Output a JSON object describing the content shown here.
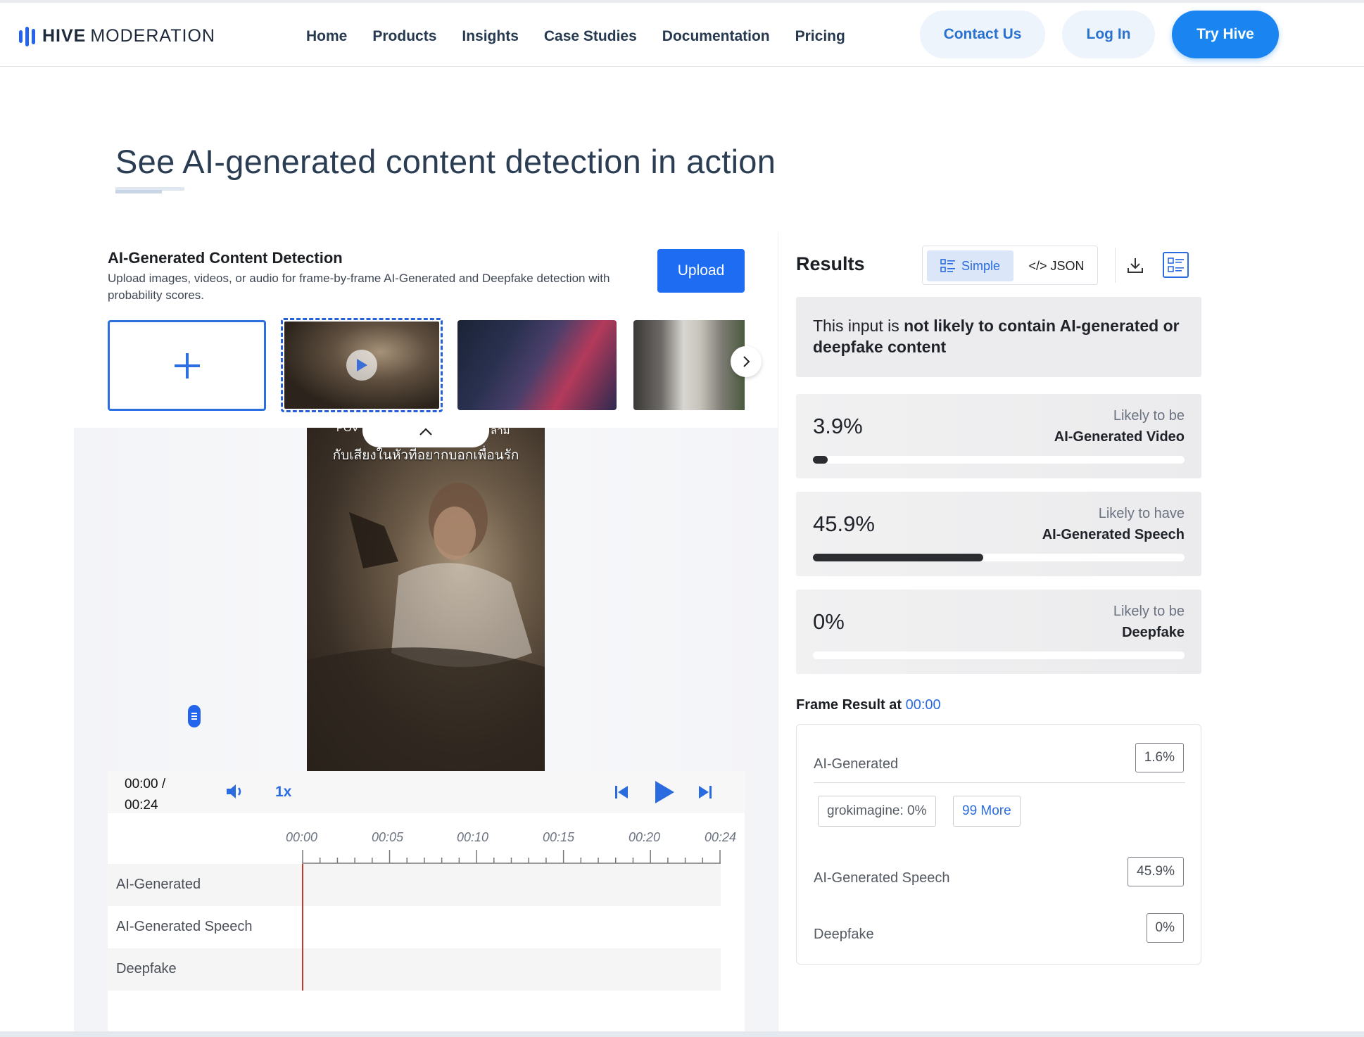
{
  "brand": {
    "name_bold": "HIVE",
    "name_light": "MODERATION",
    "color": "#2463eb"
  },
  "nav": {
    "items": [
      "Home",
      "Products",
      "Insights",
      "Case Studies",
      "Documentation",
      "Pricing"
    ],
    "contact": "Contact Us",
    "login": "Log In",
    "try": "Try Hive"
  },
  "hero": {
    "title": "See AI-generated content detection in action"
  },
  "demo": {
    "title": "AI-Generated Content Detection",
    "description": "Upload images, videos, or audio for frame-by-frame AI-Generated and Deepfake detection with probability scores.",
    "upload_label": "Upload",
    "video_caption_top": "POV",
    "video_caption_top_right": "ลาม",
    "video_caption": "กับเสียงในหัวที่อยากบอกเพื่อนรัก"
  },
  "player": {
    "time_current": "00:00 /",
    "time_total": "00:24",
    "speed": "1x",
    "ticks": [
      "00:00",
      "00:05",
      "00:10",
      "00:15",
      "00:20",
      "00:24"
    ],
    "rows": [
      "AI-Generated",
      "AI-Generated Speech",
      "Deepfake"
    ]
  },
  "results": {
    "title": "Results",
    "view_simple": "Simple",
    "view_json": "</> JSON",
    "verdict_prefix": "This input is",
    "verdict_bold": "not likely to contain AI-generated or deepfake content",
    "scores": [
      {
        "value": "3.9%",
        "fraction": 0.039,
        "label1": "Likely to be",
        "label2": "AI-Generated Video"
      },
      {
        "value": "45.9%",
        "fraction": 0.459,
        "label1": "Likely to have",
        "label2": "AI-Generated Speech"
      },
      {
        "value": "0%",
        "fraction": 0.0,
        "label1": "Likely to be",
        "label2": "Deepfake"
      }
    ],
    "frame_title": "Frame Result at",
    "frame_time": "00:00",
    "frame": {
      "ai_generated_label": "AI-Generated",
      "ai_generated_value": "1.6%",
      "chip_model": "grokimagine: 0%",
      "chip_more": "99 More",
      "speech_label": "AI-Generated Speech",
      "speech_value": "45.9%",
      "deepfake_label": "Deepfake",
      "deepfake_value": "0%"
    }
  },
  "colors": {
    "accent": "#1a85f0",
    "primary_button": "#1d6cf2",
    "playhead": "#c0392b"
  }
}
